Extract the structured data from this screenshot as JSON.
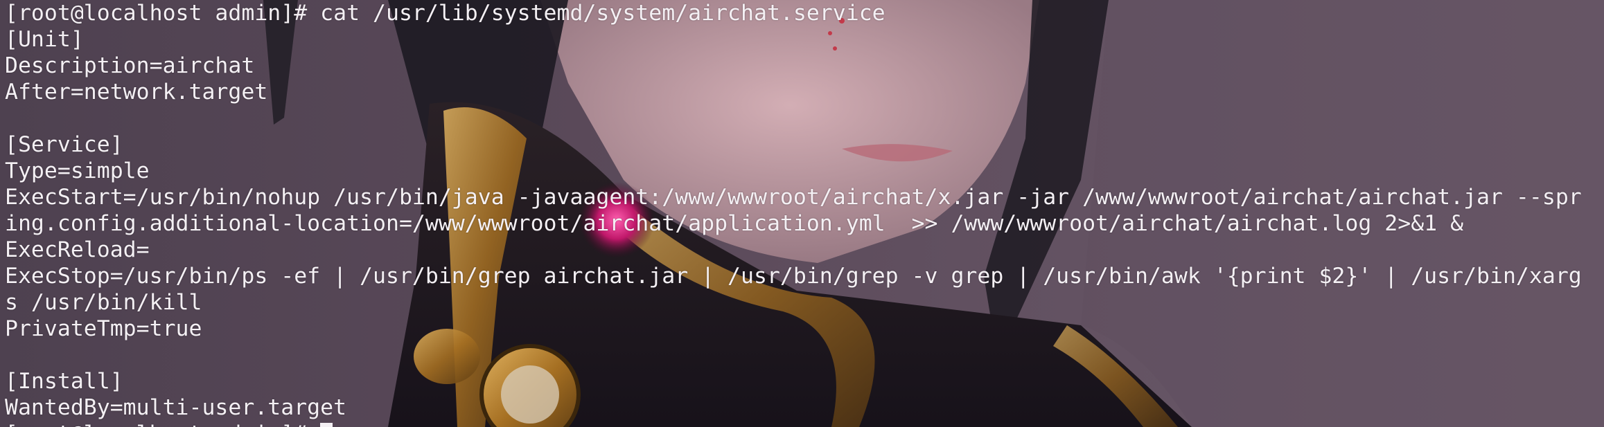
{
  "terminal": {
    "lines": [
      "[root@localhost admin]# cat /usr/lib/systemd/system/airchat.service",
      "[Unit]",
      "Description=airchat",
      "After=network.target",
      "",
      "[Service]",
      "Type=simple",
      "ExecStart=/usr/bin/nohup /usr/bin/java -javaagent:/www/wwwroot/airchat/x.jar -jar /www/wwwroot/airchat/airchat.jar --spr",
      "ing.config.additional-location=/www/wwwroot/airchat/application.yml  >> /www/wwwroot/airchat/airchat.log 2>&1 &",
      "ExecReload=",
      "ExecStop=/usr/bin/ps -ef | /usr/bin/grep airchat.jar | /usr/bin/grep -v grep | /usr/bin/awk '{print $2}' | /usr/bin/xarg",
      "s /usr/bin/kill",
      "PrivateTmp=true",
      "",
      "[Install]",
      "WantedBy=multi-user.target"
    ],
    "partial_prompt": "[root@localhost admin]# "
  },
  "colors": {
    "foreground": "#f4f0f4",
    "background": "#5b4a5a",
    "accent_gold": "#b8862e",
    "accent_magenta": "#d0206a"
  },
  "background_image": {
    "icon": "anime-character-wallpaper-icon"
  }
}
